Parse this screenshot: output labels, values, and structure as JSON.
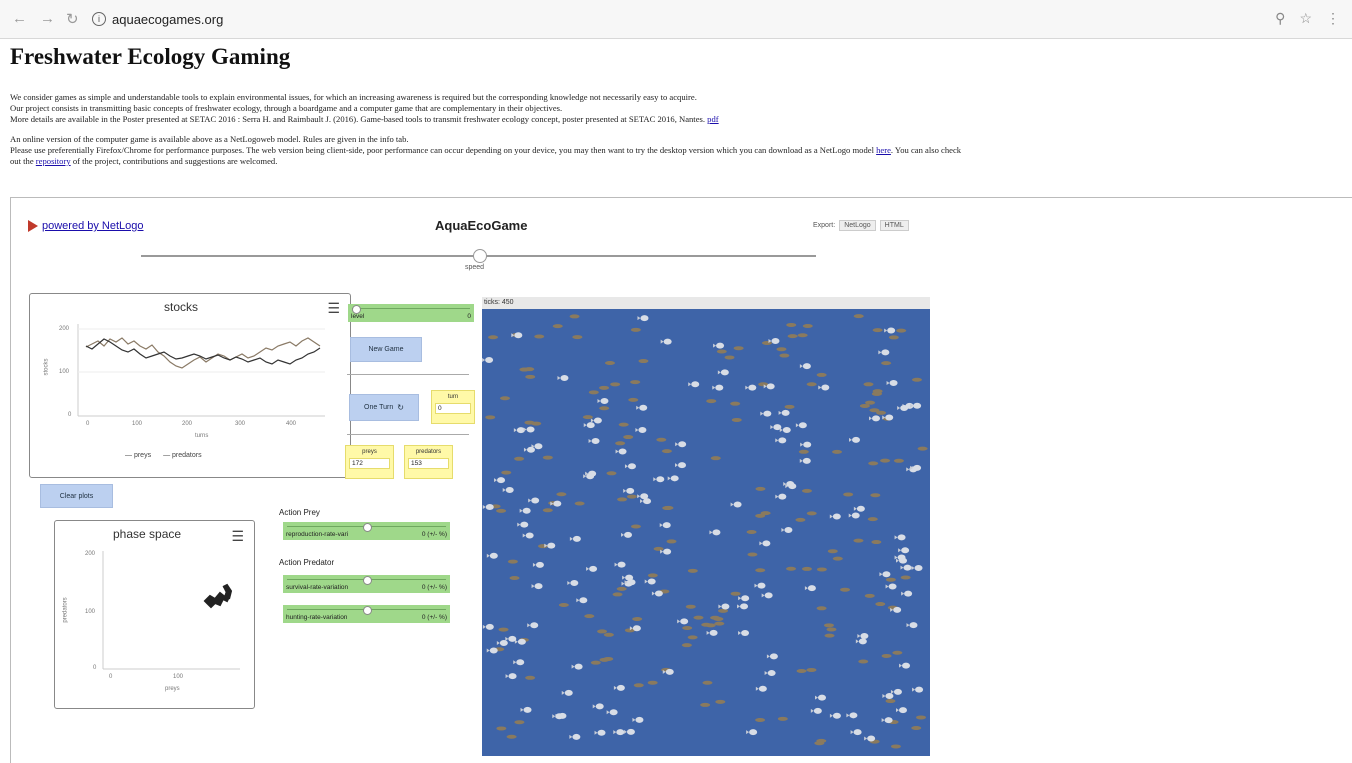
{
  "browser": {
    "url": "aquaecogames.org",
    "back_icon": "arrow-left-icon",
    "forward_icon": "arrow-right-icon",
    "reload_icon": "reload-icon"
  },
  "page": {
    "title": "Freshwater Ecology Gaming",
    "para1_line1": "We consider games as simple and understandable tools to explain environmental issues, for which an increasing awareness is required but the corresponding knowledge not necessarily easy to acquire.",
    "para1_line2": "Our project consists in transmitting basic concepts of freshwater ecology, through a boardgame and a computer game that are complementary in their objectives.",
    "para1_line3": "More details are available in the Poster presented at SETAC 2016 : Serra H. and Raimbault J. (2016). Game-based tools to transmit freshwater ecology concept, poster presented at SETAC 2016, Nantes.",
    "pdf_link": "pdf",
    "para2_line1": "An online version of the computer game is available above as a NetLogoweb model. Rules are given in the info tab.",
    "para2_line2a": "Please use preferentially Firefox/Chrome for performance purposes. The web version being client-side, poor performance can occur depending on your device, you may then want to try the desktop version which you can download as a NetLogo model",
    "here_link": "here",
    "para2_line2b": ". You can also check",
    "para2_line3a": "out the",
    "repository_link": "repository",
    "para2_line3b": "of the project, contributions and suggestions are welcomed."
  },
  "app": {
    "powered_by": "powered by NetLogo",
    "title": "AquaEcoGame",
    "export_label": "Export:",
    "export_netlogo": "NetLogo",
    "export_html": "HTML",
    "speed_label": "speed",
    "speed_level": 0.5,
    "level_slider": {
      "label": "level",
      "value": "0",
      "position": 0.0
    },
    "new_game_button": "New Game",
    "one_turn_button": "One Turn",
    "turn_monitor": {
      "label": "turn",
      "value": "0"
    },
    "preys_monitor": {
      "label": "preys",
      "value": "172"
    },
    "predators_monitor": {
      "label": "predators",
      "value": "153"
    },
    "clear_plots_button": "Clear plots",
    "action_prey_label": "Action Prey",
    "reproduction_slider": {
      "label": "reproduction-rate-vari",
      "value": "0 (+/- %)",
      "position": 0.5
    },
    "action_predator_label": "Action Predator",
    "survival_slider": {
      "label": "survival-rate-variation",
      "value": "0 (+/- %)",
      "position": 0.5
    },
    "hunting_slider": {
      "label": "hunting-rate-variation",
      "value": "0 (+/- %)",
      "position": 0.5
    },
    "ticks_label": "ticks: 450",
    "world_color": "#3e64a8"
  },
  "stocks_plot": {
    "title": "stocks",
    "xlabel": "turns",
    "ylabel": "stocks",
    "x_ticks": [
      "0",
      "100",
      "200",
      "300",
      "400"
    ],
    "y_ticks": [
      "0",
      "100",
      "200"
    ],
    "legend": [
      "preys",
      "predators"
    ]
  },
  "phase_plot": {
    "title": "phase space",
    "xlabel": "preys",
    "ylabel": "predators",
    "x_ticks": [
      "0",
      "100"
    ],
    "y_ticks": [
      "0",
      "100",
      "200"
    ]
  }
}
